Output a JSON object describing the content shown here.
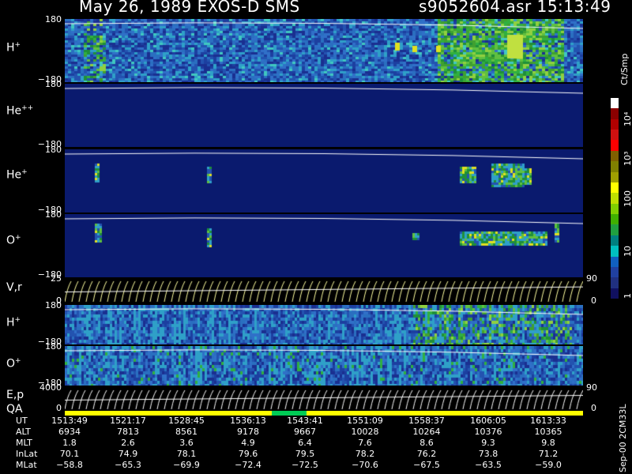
{
  "title": {
    "left": "May 26, 1989   EXOS-D SMS",
    "right": "s9052604.asr  15:13:49"
  },
  "panels": [
    {
      "id": "hplus",
      "label_main": "H",
      "label_sup": "+",
      "ytop": "180",
      "ybot": "−180",
      "colors": [
        "#1c3fa0",
        "#2a6fc0",
        "#2fa0c8",
        "#40c0b0",
        "#1f7f3a",
        "#3fb040",
        "#90d040",
        "#e0e020"
      ]
    },
    {
      "id": "hepp",
      "label_main": "He",
      "label_sup": "++",
      "ytop": "180",
      "ybot": "−180"
    },
    {
      "id": "heplus",
      "label_main": "He",
      "label_sup": "+",
      "ytop": "180",
      "ybot": "−180"
    },
    {
      "id": "oplus",
      "label_main": "O",
      "label_sup": "+",
      "ytop": "180",
      "ybot": "−180"
    },
    {
      "id": "vr",
      "label_main": "V,r",
      "label_sup": "",
      "ytop": "25",
      "ybot": "0",
      "rtop": "90",
      "rbot": "0"
    },
    {
      "id": "hplus2",
      "label_main": "H",
      "label_sup": "+",
      "ytop": "180",
      "ybot": "−180"
    },
    {
      "id": "oplus2",
      "label_main": "O",
      "label_sup": "+",
      "ytop": "180",
      "ybot": "−180"
    },
    {
      "id": "ep",
      "label_main": "E,p",
      "label_sup": "",
      "ytop": "4000",
      "ybot": "0",
      "rtop": "90",
      "rbot": "0"
    }
  ],
  "qa_label": "QA",
  "colorbar": {
    "unit_label": "Ct/Smp",
    "tick_labels": [
      "10⁴",
      "10³",
      "100",
      "10",
      "1"
    ],
    "colors": [
      "#ffffff",
      "#8b0000",
      "#b00000",
      "#d01010",
      "#ff0000",
      "#806000",
      "#808000",
      "#a0a000",
      "#ffff00",
      "#c0e000",
      "#80d000",
      "#40b000",
      "#20a040",
      "#008080",
      "#00c0c0",
      "#1060c0",
      "#2040a0",
      "#203080",
      "#101060"
    ]
  },
  "side_text": "Sep-00  2CM33L",
  "chart_data": {
    "type": "heatmap",
    "title": "May 26, 1989   EXOS-D SMS",
    "file": "s9052604.asr  15:13:49",
    "time_ticks": [
      "1513:49",
      "1521:17",
      "1528:45",
      "1536:13",
      "1543:41",
      "1551:09",
      "1558:37",
      "1606:05",
      "1613:33"
    ],
    "rows": [
      {
        "name": "UT",
        "values": [
          "1513:49",
          "1521:17",
          "1528:45",
          "1536:13",
          "1543:41",
          "1551:09",
          "1558:37",
          "1606:05",
          "1613:33"
        ]
      },
      {
        "name": "ALT",
        "values": [
          "6934",
          "7813",
          "8561",
          "9178",
          "9667",
          "10028",
          "10264",
          "10376",
          "10365"
        ]
      },
      {
        "name": "MLT",
        "values": [
          "1.8",
          "2.6",
          "3.6",
          "4.9",
          "6.4",
          "7.6",
          "8.6",
          "9.3",
          "9.8"
        ]
      },
      {
        "name": "InLat",
        "values": [
          "70.1",
          "74.9",
          "78.1",
          "79.6",
          "79.5",
          "78.2",
          "76.2",
          "73.8",
          "71.2"
        ]
      },
      {
        "name": "MLat",
        "values": [
          "−58.8",
          "−65.3",
          "−69.9",
          "−72.4",
          "−72.5",
          "−70.6",
          "−67.5",
          "−63.5",
          "−59.0"
        ]
      }
    ]
  }
}
